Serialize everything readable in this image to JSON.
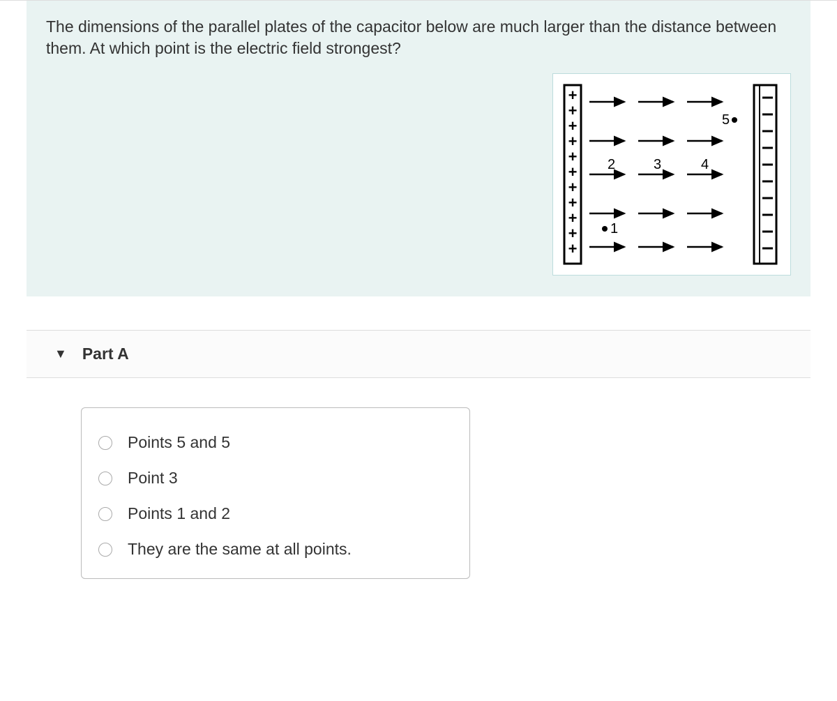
{
  "question": {
    "text": "The dimensions of the parallel plates of the capacitor below are much larger than the distance between them. At which point is the electric field strongest?",
    "figure": {
      "left_plate_charge": "+",
      "right_plate_charge": "−",
      "points": [
        "1",
        "2",
        "3",
        "4",
        "5"
      ]
    }
  },
  "part": {
    "title": "Part A",
    "options": [
      "Points 5 and 5",
      "Point 3",
      "Points 1 and 2",
      "They are the same at all points."
    ]
  }
}
